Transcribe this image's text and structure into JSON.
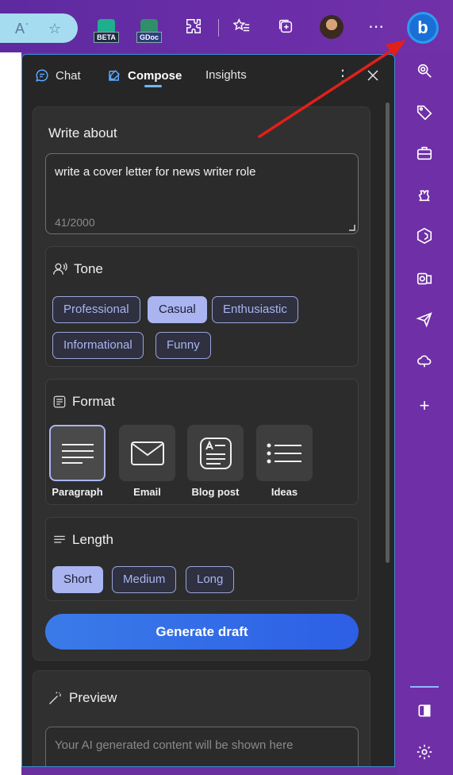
{
  "panel": {
    "tabs": [
      {
        "label": "Chat",
        "icon": "chat-icon"
      },
      {
        "label": "Compose",
        "icon": "compose-icon"
      },
      {
        "label": "Insights",
        "icon": ""
      }
    ],
    "active_tab": "Compose"
  },
  "toolbar": {
    "extensions": [
      {
        "name": "beta-extension",
        "label": "BETA"
      },
      {
        "name": "gdoc-extension",
        "label": "GDoc"
      }
    ]
  },
  "write_about": {
    "heading": "Write about",
    "value": "write a cover letter for news writer role",
    "counter": "41/2000"
  },
  "tone": {
    "heading": "Tone",
    "options": [
      "Professional",
      "Casual",
      "Enthusiastic",
      "Informational",
      "Funny"
    ],
    "selected": "Casual"
  },
  "format": {
    "heading": "Format",
    "options": [
      "Paragraph",
      "Email",
      "Blog post",
      "Ideas"
    ],
    "selected": "Paragraph"
  },
  "length": {
    "heading": "Length",
    "options": [
      "Short",
      "Medium",
      "Long"
    ],
    "selected": "Short"
  },
  "generate_label": "Generate draft",
  "preview": {
    "heading": "Preview",
    "placeholder": "Your AI generated content will be shown here"
  },
  "colors": {
    "accent": "#a9b4f0",
    "sidebar": "#6f2fa6",
    "panel_bg": "#262626",
    "generate_button": "#3a7be8",
    "annotation_arrow": "#e0201a"
  }
}
